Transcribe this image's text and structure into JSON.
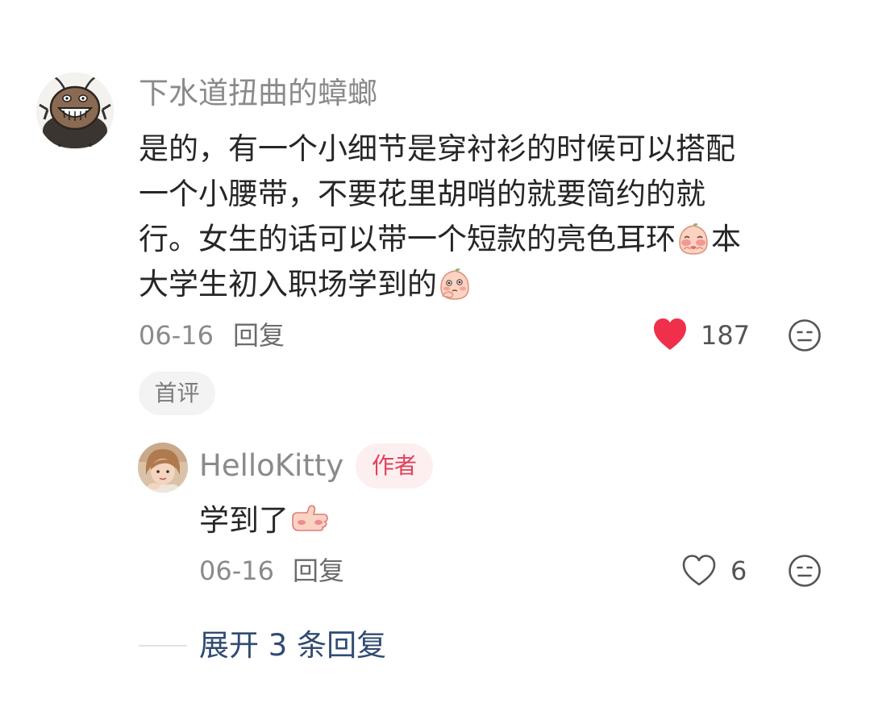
{
  "comment": {
    "username": "下水道扭曲的蟑螂",
    "text_lines": [
      "是的，有一个小细节是穿衬衫的时候可以搭配",
      "一个小腰带，不要花里胡哨的就要简约的就",
      "行。女生的话可以带一个短款的亮色耳环",
      "本",
      "大学生初入职场学到的"
    ],
    "date": "06-16",
    "reply_label": "回复",
    "like_count": "187",
    "liked": true,
    "first_badge": "首评",
    "avatar_icon": "cockroach-cartoon-avatar",
    "emojis": [
      "blushing-peach-emoji",
      "thinking-peach-emoji"
    ]
  },
  "reply": {
    "username": "HelloKitty",
    "author_badge": "作者",
    "text": "学到了",
    "date": "06-16",
    "reply_label": "回复",
    "like_count": "6",
    "liked": false,
    "avatar_icon": "girl-photo-avatar",
    "emoji": "thumbs-up-emoji"
  },
  "expand": {
    "label": "展开 3 条回复"
  },
  "colors": {
    "like_red": "#f0304b",
    "author_badge_text": "#e0415a",
    "author_badge_bg": "#fdeef0",
    "expand_link": "#314b72",
    "muted_text": "#8a8a8a"
  }
}
